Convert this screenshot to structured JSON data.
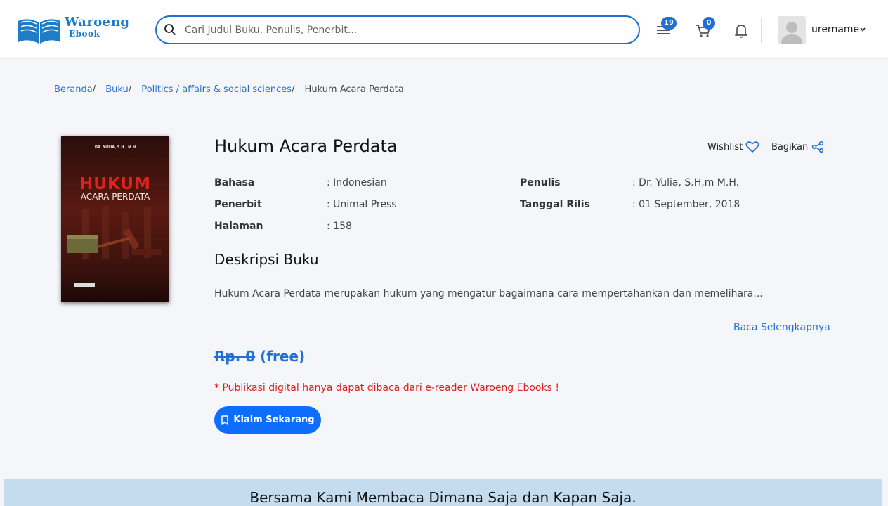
{
  "header": {
    "logo_title": "Waroeng",
    "logo_subtitle": "Ebook",
    "search_placeholder": "Cari Judul Buku, Penulis, Penerbit...",
    "menu_badge": "19",
    "cart_badge": "0",
    "username": "urername"
  },
  "breadcrumb": {
    "items": [
      "Beranda",
      "Buku",
      "Politics / affairs & social sciences"
    ],
    "current": "Hukum Acara Perdata"
  },
  "cover": {
    "author": "DR. YULIA, S.H., M.H",
    "title_line1": "HUKUM",
    "title_line2": "ACARA PERDATA"
  },
  "book": {
    "title": "Hukum Acara Perdata",
    "wishlist_label": "Wishlist",
    "share_label": "Bagikan",
    "meta": {
      "bahasa_label": "Bahasa",
      "bahasa_value": ": Indonesian",
      "penerbit_label": "Penerbit",
      "penerbit_value": ": Unimal Press",
      "halaman_label": "Halaman",
      "halaman_value": ": 158",
      "penulis_label": "Penulis",
      "penulis_value": ": Dr. Yulia, S.H,m M.H.",
      "tanggal_label": "Tanggal Rilis",
      "tanggal_value": ": 01 September, 2018"
    },
    "description_heading": "Deskripsi Buku",
    "description": "Hukum Acara Perdata merupakan hukum yang mengatur bagaimana cara mempertahankan dan memelihara...",
    "read_more": "Baca Selengkapnya",
    "price_original": "Rp. 0",
    "price_free": "(free)",
    "notice": "* Publikasi digital hanya dapat dibaca dari e-reader Waroeng Ebooks !",
    "claim_label": "Klaim Sekarang"
  },
  "banner": {
    "text": "Bersama Kami Membaca Dimana Saja dan Kapan Saja."
  },
  "colors": {
    "accent": "#1f6fd6",
    "button": "#0d6efd",
    "notice": "#e02020",
    "banner": "#c4dcee"
  }
}
